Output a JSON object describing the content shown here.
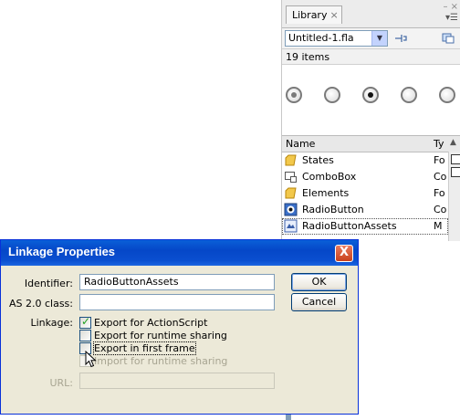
{
  "library": {
    "tab_label": "Library",
    "tab_close": "×",
    "window_controls": "– ×",
    "panel_menu": "▾☰",
    "file_select_value": "Untitled-1.fla",
    "item_count": "19 items",
    "columns": {
      "name": "Name",
      "type": "Ty"
    },
    "items": [
      {
        "name": "States",
        "type": "Fo",
        "icon": "folder-icon"
      },
      {
        "name": "ComboBox",
        "type": "Co",
        "icon": "component-icon"
      },
      {
        "name": "Elements",
        "type": "Fo",
        "icon": "folder-icon"
      },
      {
        "name": "RadioButton",
        "type": "Co",
        "icon": "radio-component-icon"
      },
      {
        "name": "RadioButtonAssets",
        "type": "M",
        "icon": "movieclip-icon"
      }
    ]
  },
  "dialog": {
    "title": "Linkage Properties",
    "close_glyph": "X",
    "identifier_label": "Identifier:",
    "identifier_value": "RadioButtonAssets",
    "class_label": "AS 2.0 class:",
    "class_value": "",
    "linkage_label": "Linkage:",
    "url_label": "URL:",
    "url_value": "",
    "ok_label": "OK",
    "cancel_label": "Cancel",
    "options": [
      {
        "label": "Export for ActionScript",
        "checked": true,
        "enabled": true
      },
      {
        "label": "Export for runtime sharing",
        "checked": false,
        "enabled": true
      },
      {
        "label": "Export in first frame",
        "checked": false,
        "enabled": true
      },
      {
        "label": "Import for runtime sharing",
        "checked": false,
        "enabled": false
      }
    ]
  },
  "colors": {
    "title_bar": "#0a5fd8",
    "dialog_bg": "#ece9d8",
    "close_button": "#d7512c"
  }
}
